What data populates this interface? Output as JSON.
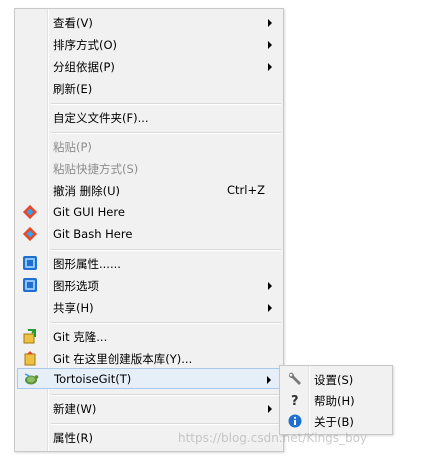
{
  "menu": {
    "items": [
      {
        "label": "查看(V)"
      },
      {
        "label": "排序方式(O)"
      },
      {
        "label": "分组依据(P)"
      },
      {
        "label": "刷新(E)"
      },
      {
        "label": "自定义文件夹(F)..."
      },
      {
        "label": "粘贴(P)"
      },
      {
        "label": "粘贴快捷方式(S)"
      },
      {
        "label": "撤消 删除(U)",
        "shortcut": "Ctrl+Z"
      },
      {
        "label": "Git GUI Here"
      },
      {
        "label": "Git Bash Here"
      },
      {
        "label": "图形属性......"
      },
      {
        "label": "图形选项"
      },
      {
        "label": "共享(H)"
      },
      {
        "label": "Git 克隆..."
      },
      {
        "label": "Git 在这里创建版本库(Y)..."
      },
      {
        "label": "TortoiseGit(T)"
      },
      {
        "label": "新建(W)"
      },
      {
        "label": "属性(R)"
      }
    ]
  },
  "submenu": {
    "items": [
      {
        "label": "设置(S)"
      },
      {
        "label": "帮助(H)"
      },
      {
        "label": "关于(B)"
      }
    ]
  },
  "watermark": "https://blog.csdn.net/Kings_boy",
  "colors": {
    "menu_bg": "#f1f1f1",
    "highlight_bg": "#e6eef8",
    "highlight_border": "#a8c8ec",
    "disabled_text": "#8d8d8d",
    "git_red": "#e8472c",
    "intel_blue": "#1f6fd1"
  }
}
